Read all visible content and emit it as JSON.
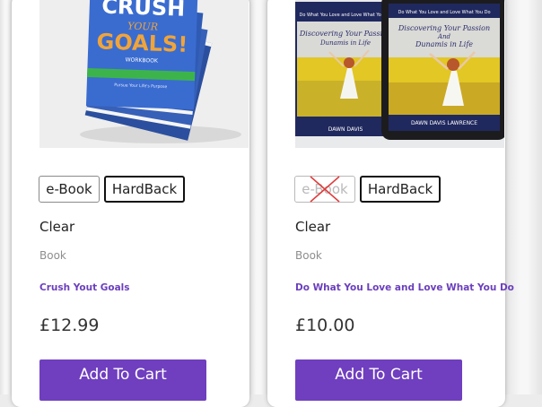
{
  "colors": {
    "accent": "#6f3fbf",
    "title": "#6b3fbd",
    "price": "#333333",
    "muted": "#8e8e8e"
  },
  "products": [
    {
      "cover_lines": [
        "CRUSH",
        "YOUR",
        "GOALS!"
      ],
      "cover_sub": "WORKBOOK",
      "cover_tag": "Pursue Your Life's Purpose",
      "variants": [
        {
          "label": "e-Book",
          "state": "available"
        },
        {
          "label": "HardBack",
          "state": "selected"
        }
      ],
      "clear_label": "Clear",
      "category": "Book",
      "title": "Crush Yout Goals",
      "price": "£12.99",
      "cart_label": "Add To Cart"
    },
    {
      "cover_top": "Do What You Love and Love What You Do",
      "cover_title_lines": [
        "Discovering Your Passion",
        "And",
        "Dunamis in Life"
      ],
      "cover_author": "DAWN DAVIS LAWRENCE",
      "variants": [
        {
          "label": "e-Book",
          "state": "unavailable"
        },
        {
          "label": "HardBack",
          "state": "selected"
        }
      ],
      "clear_label": "Clear",
      "category": "Book",
      "title": "Do What You Love and Love What You Do",
      "price": "£10.00",
      "cart_label": "Add To Cart"
    }
  ]
}
